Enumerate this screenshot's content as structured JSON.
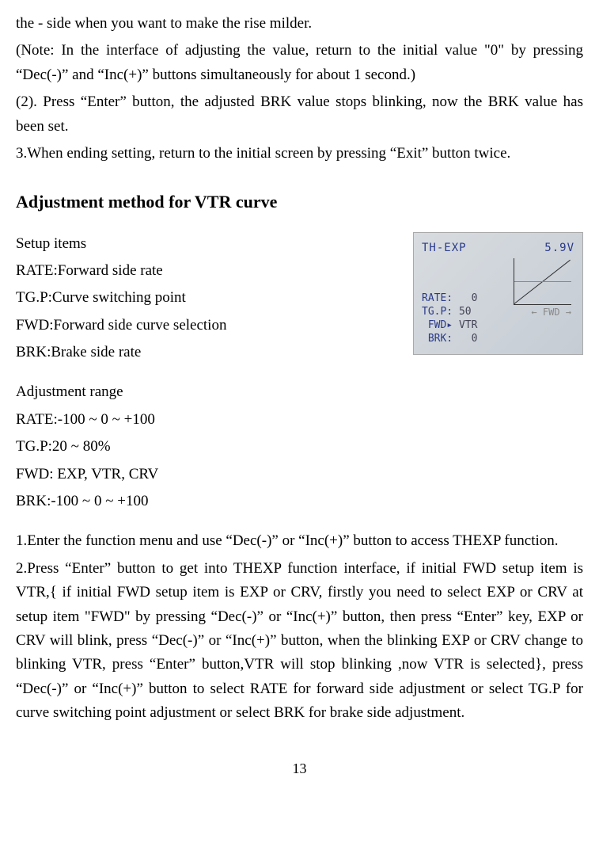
{
  "para1": "the - side when you want to make the rise milder.",
  "para2": "(Note: In the interface of adjusting the value, return to the initial value \"0\" by pressing “Dec(-)” and “Inc(+)” buttons simultaneously for about 1 second.)",
  "para3": "(2). Press  “Enter” button, the adjusted BRK value stops blinking, now the BRK value has been set.",
  "para4": "3.When ending setting, return to the initial screen by pressing “Exit” button twice.",
  "heading": "Adjustment method for VTR curve",
  "setup_title": "Setup items",
  "setup_rate": "RATE:Forward side rate",
  "setup_tgp": "TG.P:Curve switching point",
  "setup_fwd": "FWD:Forward side curve selection",
  "setup_brk": "BRK:Brake side rate",
  "range_title": "Adjustment  range",
  "range_rate": "RATE:-100 ~ 0 ~ +100",
  "range_tgp": "TG.P:20 ~ 80%",
  "range_fwd": "FWD: EXP, VTR, CRV",
  "range_brk": "BRK:-100 ~ 0 ~ +100",
  "step1": "1.Enter the function menu and use  “Dec(-)” or “Inc(+)” button to access THEXP function.",
  "step2": "2.Press “Enter” button to get into THEXP function interface, if initial FWD setup item is VTR,{ if initial FWD setup item is EXP or CRV, firstly you need to select EXP or CRV at setup item \"FWD\" by pressing “Dec(-)” or “Inc(+)” button, then press “Enter” key, EXP  or CRV will blink, press “Dec(-)” or “Inc(+)” button, when the blinking EXP or CRV change to blinking VTR, press “Enter” button,VTR will stop blinking ,now VTR is selected}, press “Dec(-)” or “Inc(+)” button to select RATE for forward side adjustment or select TG.P for curve switching point adjustment or select BRK for brake side adjustment.",
  "page_number": "13",
  "screen": {
    "title": "TH-EXP",
    "voltage": "5.9V",
    "rate_label": "RATE:",
    "rate_val": "0",
    "tgp_label": "TG.P:",
    "tgp_val": "50",
    "fwd_label": "FWD▸",
    "fwd_val": "VTR",
    "brk_label": "BRK:",
    "brk_val": "0",
    "side_label": "← FWD →"
  }
}
